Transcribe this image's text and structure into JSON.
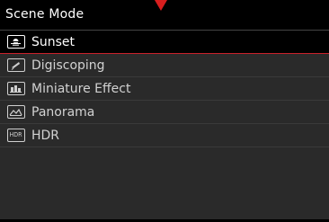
{
  "header": {
    "title": "Scene Mode"
  },
  "menu": {
    "items": [
      {
        "label": "Sunset",
        "icon": "sunset-icon",
        "selected": true
      },
      {
        "label": "Digiscoping",
        "icon": "telescope-icon",
        "selected": false
      },
      {
        "label": "Miniature Effect",
        "icon": "miniature-icon",
        "selected": false
      },
      {
        "label": "Panorama",
        "icon": "panorama-icon",
        "selected": false
      },
      {
        "label": "HDR",
        "icon": "hdr-icon",
        "icon_text": "HDR",
        "selected": false
      }
    ]
  },
  "colors": {
    "background": "#000000",
    "list_background": "#2a2a2a",
    "accent": "#c9202a",
    "marker": "#d81e1e",
    "text": "#ffffff"
  }
}
